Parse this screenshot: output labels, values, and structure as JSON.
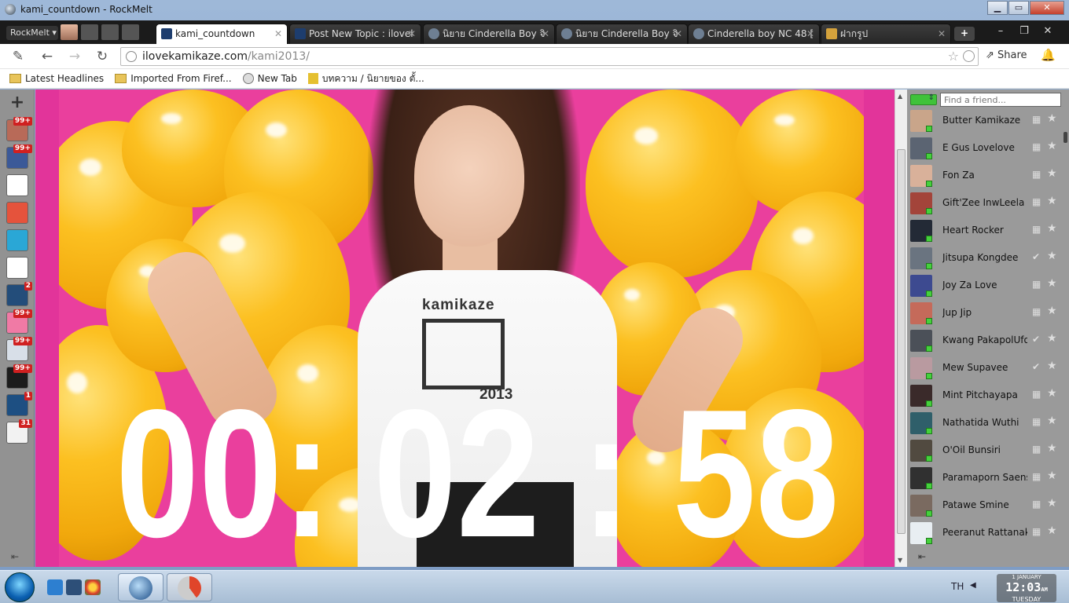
{
  "window": {
    "title": "kami_countdown - RockMelt"
  },
  "tabstrip": {
    "menu_label": "RockMelt ▾",
    "tabs": [
      {
        "label": "kami_countdown",
        "active": true,
        "icon": "kamikaze-k-icon"
      },
      {
        "label": "Post New Topic : ilovel",
        "active": false,
        "icon": "kamikaze-k-icon"
      },
      {
        "label": "นิยาย Cinderella Boy จิ",
        "active": false,
        "icon": "globe-icon"
      },
      {
        "label": "นิยาย Cinderella Boy จิ",
        "active": false,
        "icon": "globe-icon"
      },
      {
        "label": "Cinderella boy NC 48 [",
        "active": false,
        "icon": "globe-icon"
      },
      {
        "label": "ฝากรูป",
        "active": false,
        "icon": "ld-icon"
      }
    ],
    "new_tab_label": "+"
  },
  "toolbar": {
    "url_host": "ilovekamikaze.com",
    "url_path": "/kami2013/",
    "share_label": "Share"
  },
  "bookmarks": [
    {
      "label": "Latest Headlines",
      "icon": "folder-icon"
    },
    {
      "label": "Imported From Firef...",
      "icon": "folder-icon"
    },
    {
      "label": "New Tab",
      "icon": "globe-icon"
    },
    {
      "label": "บทความ / นิยายของ ตั้...",
      "icon": "document-icon"
    }
  ],
  "left_rail": {
    "items": [
      {
        "name": "profile-avatar-app",
        "badge": "99+",
        "color": "#b86a58"
      },
      {
        "name": "facebook-app",
        "badge": "99+",
        "color": "#3b5998"
      },
      {
        "name": "gmail-app",
        "badge": "",
        "color": "#ffffff"
      },
      {
        "name": "google-plus-app",
        "badge": "",
        "color": "#e5533c"
      },
      {
        "name": "meebo-app",
        "badge": "",
        "color": "#2aa7d6"
      },
      {
        "name": "youtube-app",
        "badge": "",
        "color": "#ffffff"
      },
      {
        "name": "globe-app",
        "badge": "2",
        "color": "#234d7a"
      },
      {
        "name": "heart-app",
        "badge": "99+",
        "color": "#f07aa5"
      },
      {
        "name": "shield-app",
        "badge": "99+",
        "color": "#d8dfe8"
      },
      {
        "name": "lol-app",
        "badge": "99+",
        "color": "#1c1c1c"
      },
      {
        "name": "clock-app",
        "badge": "1",
        "color": "#1d4f82"
      },
      {
        "name": "bird-app",
        "badge": "31",
        "color": "#f2f2f2"
      }
    ]
  },
  "page": {
    "countdown": {
      "hours": "00",
      "minutes": "02",
      "seconds": "58",
      "sep": ":"
    },
    "shirt": {
      "brand": "kamikaze",
      "year": "2013"
    }
  },
  "friends": {
    "search_placeholder": "Find a friend...",
    "list": [
      {
        "name": "Butter Kamikaze",
        "status": "gift",
        "avatar": "#c9a58a"
      },
      {
        "name": "E Gus Lovelove",
        "status": "gift",
        "avatar": "#5b6472"
      },
      {
        "name": "Fon Za",
        "status": "gift",
        "avatar": "#d9b19a"
      },
      {
        "name": "Gift'Zee InwLeela",
        "status": "gift",
        "avatar": "#a3443a"
      },
      {
        "name": "Heart Rocker",
        "status": "gift",
        "avatar": "#232a36"
      },
      {
        "name": "Jitsupa Kongdee",
        "status": "check",
        "avatar": "#6a7480"
      },
      {
        "name": "Joy Za Love",
        "status": "gift",
        "avatar": "#3d4a90"
      },
      {
        "name": "Jup Jip",
        "status": "gift",
        "avatar": "#c56a5a"
      },
      {
        "name": "Kwang PakapolUfo...",
        "status": "check",
        "avatar": "#4b5058"
      },
      {
        "name": "Mew Supavee",
        "status": "check",
        "avatar": "#b99aa0"
      },
      {
        "name": "Mint Pitchayapa",
        "status": "gift",
        "avatar": "#3a2a2a"
      },
      {
        "name": "Nathatida Wuthi",
        "status": "gift",
        "avatar": "#2f5f6a"
      },
      {
        "name": "O'Oil Bunsiri",
        "status": "gift",
        "avatar": "#514a40"
      },
      {
        "name": "Paramaporn Saens...",
        "status": "gift",
        "avatar": "#303030"
      },
      {
        "name": "Patawe Smine",
        "status": "gift",
        "avatar": "#7a6a60"
      },
      {
        "name": "Peeranut Rattanak...",
        "status": "gift",
        "avatar": "#e8eef2"
      }
    ]
  },
  "taskbar": {
    "language": "TH",
    "clock": {
      "date_top": "1 JANUARY",
      "time": "12:03",
      "ampm": "AM",
      "day": "TUESDAY"
    }
  }
}
